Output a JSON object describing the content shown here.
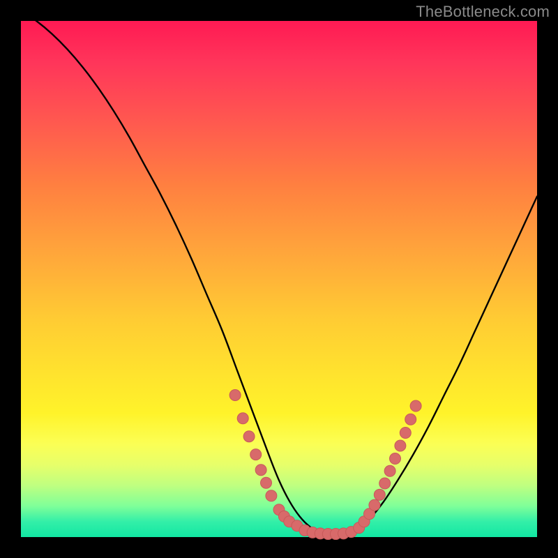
{
  "watermark": "TheBottleneck.com",
  "colors": {
    "background": "#000000",
    "curve": "#000000",
    "marker_fill": "#d86a6a",
    "marker_stroke": "#c75a5a",
    "gradient_top": "#ff1a53",
    "gradient_bottom": "#12e7a3"
  },
  "chart_data": {
    "type": "line",
    "title": "",
    "xlabel": "",
    "ylabel": "",
    "xlim": [
      0,
      100
    ],
    "ylim": [
      0,
      100
    ],
    "grid": false,
    "legend": false,
    "series": [
      {
        "name": "curve",
        "x": [
          0,
          3,
          6,
          9,
          12,
          15,
          18,
          21,
          24,
          27,
          30,
          33,
          36,
          39,
          42,
          45,
          48,
          50,
          52,
          54,
          56,
          58,
          60,
          62,
          64,
          67,
          70,
          73,
          76,
          79,
          82,
          85,
          88,
          91,
          94,
          97,
          100
        ],
        "y": [
          102,
          100,
          97.5,
          94.5,
          91,
          87,
          82.5,
          77.5,
          72,
          66.5,
          60.5,
          54,
          47,
          40,
          32,
          24,
          16,
          11,
          7,
          4,
          2,
          1,
          0.5,
          0.5,
          1.1,
          3,
          6.5,
          11,
          16,
          21.5,
          27.5,
          33.5,
          40,
          46.5,
          53,
          59.5,
          66
        ]
      },
      {
        "name": "markers-left",
        "marker": true,
        "x": [
          41.5,
          43,
          44.2,
          45.5,
          46.5,
          47.5,
          48.5,
          50.0,
          51.0,
          52.0,
          53.5
        ],
        "y": [
          27.5,
          23,
          19.5,
          16,
          13,
          10.5,
          8,
          5.3,
          4,
          3,
          2.2
        ]
      },
      {
        "name": "markers-valley",
        "marker": true,
        "x": [
          55,
          56.5,
          58,
          59.5,
          61,
          62.5,
          64
        ],
        "y": [
          1.3,
          0.9,
          0.7,
          0.6,
          0.6,
          0.7,
          1.0
        ]
      },
      {
        "name": "markers-right",
        "marker": true,
        "x": [
          65.5,
          66.5,
          67.5,
          68.5,
          69.5,
          70.5,
          71.5,
          72.5,
          73.5,
          74.5,
          75.5,
          76.5
        ],
        "y": [
          1.8,
          3.0,
          4.5,
          6.2,
          8.2,
          10.4,
          12.8,
          15.2,
          17.7,
          20.2,
          22.8,
          25.4
        ]
      }
    ]
  }
}
